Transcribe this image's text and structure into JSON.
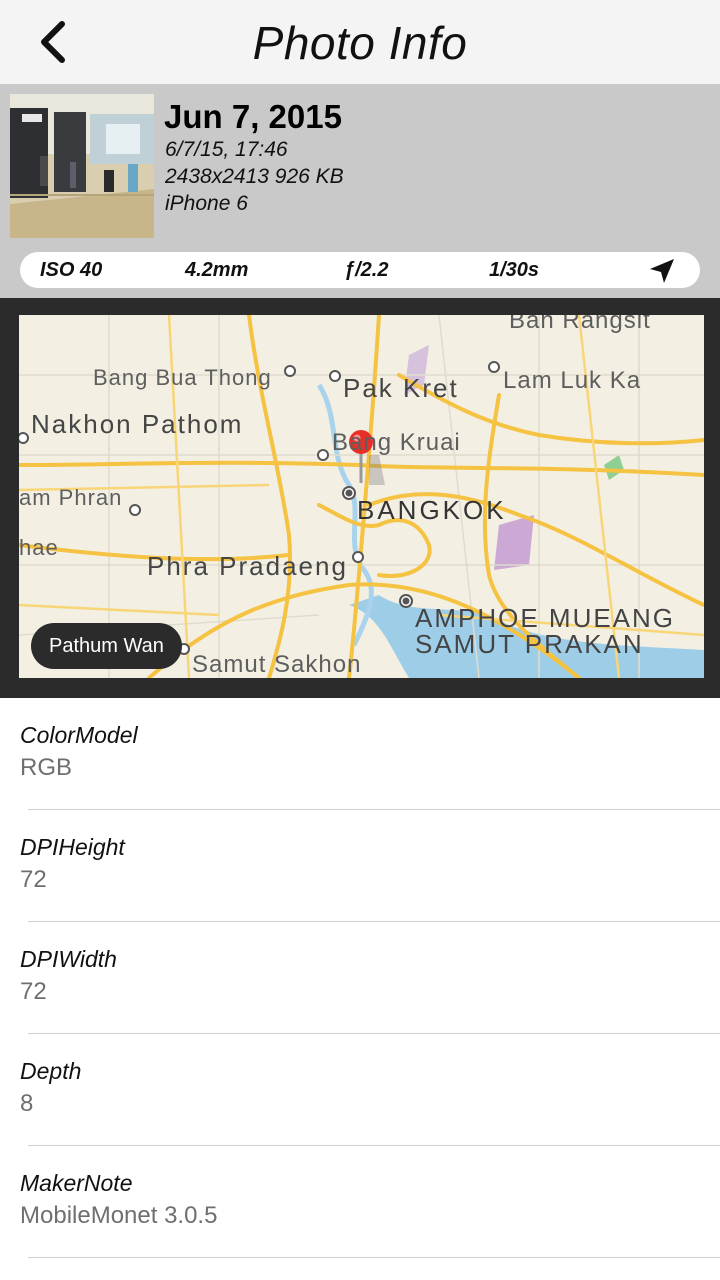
{
  "navbar": {
    "title": "Photo Info",
    "back_icon": "chevron-left-icon"
  },
  "photo": {
    "date": "Jun 7, 2015",
    "datetime": "6/7/15, 17:46",
    "size": "2438x2413 926 KB",
    "device": "iPhone 6"
  },
  "exif": {
    "iso": "ISO 40",
    "focal": "4.2mm",
    "aperture": "ƒ/2.2",
    "shutter": "1/30s",
    "location_icon": "location-arrow-icon"
  },
  "map": {
    "labels": {
      "ban_rangsit": "Ban Rangsit",
      "bang_bua_thong": "Bang Bua Thong",
      "pak_kret": "Pak Kret",
      "lam_luk_ka": "Lam Luk Ka",
      "nakhon_pathom": "Nakhon Pathom",
      "bang_kruai": "Bang Kruai",
      "am_phran": "am Phran",
      "bangkok": "BANGKOK",
      "hae": "hae",
      "phra_pradaeng": "Phra Pradaeng",
      "amphoe_line1": "AMPHOE MUEANG",
      "amphoe_line2": "SAMUT PRAKAN",
      "samut_sakhon": "Samut Sakhon"
    },
    "callout": "Pathum Wan",
    "pin_color": "#e8302a"
  },
  "properties": [
    {
      "key": "ColorModel",
      "value": "RGB"
    },
    {
      "key": "DPIHeight",
      "value": "72"
    },
    {
      "key": "DPIWidth",
      "value": "72"
    },
    {
      "key": "Depth",
      "value": "8"
    },
    {
      "key": "MakerNote",
      "value": "MobileMonet 3.0.5"
    }
  ]
}
